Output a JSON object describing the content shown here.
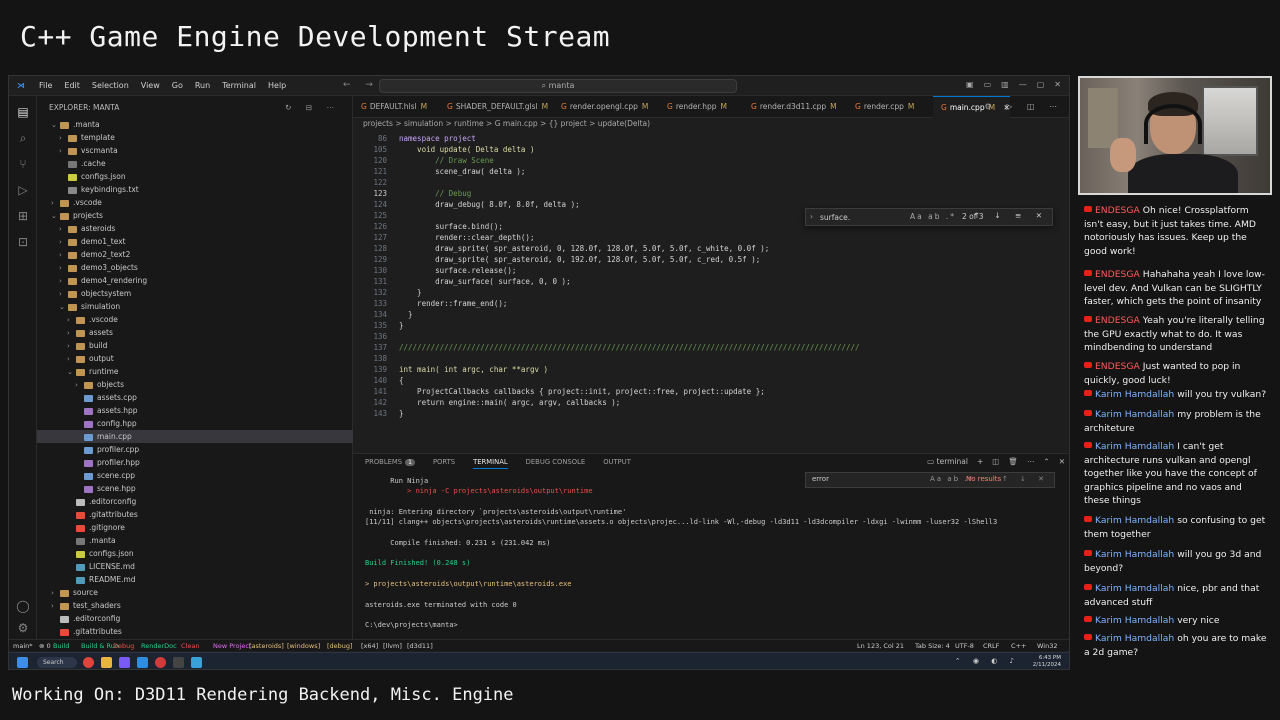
{
  "overlay": {
    "title": "C++ Game Engine Development Stream",
    "footer": "Working On: D3D11 Rendering Backend, Misc. Engine"
  },
  "titlebar": {
    "menu": [
      "File",
      "Edit",
      "Selection",
      "View",
      "Go",
      "Run",
      "Terminal",
      "Help"
    ],
    "search": "manta"
  },
  "activity_icons": [
    "files-icon",
    "search-icon",
    "source-control-icon",
    "run-debug-icon",
    "extensions-icon",
    "remote-icon",
    "accounts-icon",
    "settings-gear-icon"
  ],
  "explorer": {
    "header": "EXPLORER: MANTA",
    "items": [
      {
        "label": ".manta",
        "depth": 1,
        "kind": "folder",
        "open": true
      },
      {
        "label": "template",
        "depth": 2,
        "kind": "folder",
        "open": false
      },
      {
        "label": "vscmanta",
        "depth": 2,
        "kind": "folder",
        "open": false
      },
      {
        "label": ".cache",
        "depth": 2,
        "kind": "file"
      },
      {
        "label": "configs.json",
        "depth": 2,
        "kind": "json"
      },
      {
        "label": "keybindings.txt",
        "depth": 2,
        "kind": "txt"
      },
      {
        "label": ".vscode",
        "depth": 1,
        "kind": "folder",
        "open": false
      },
      {
        "label": "projects",
        "depth": 1,
        "kind": "folder",
        "open": true
      },
      {
        "label": "asteroids",
        "depth": 2,
        "kind": "folder",
        "open": false
      },
      {
        "label": "demo1_text",
        "depth": 2,
        "kind": "folder",
        "open": false
      },
      {
        "label": "demo2_text2",
        "depth": 2,
        "kind": "folder",
        "open": false
      },
      {
        "label": "demo3_objects",
        "depth": 2,
        "kind": "folder",
        "open": false
      },
      {
        "label": "demo4_rendering",
        "depth": 2,
        "kind": "folder",
        "open": false
      },
      {
        "label": "objectsystem",
        "depth": 2,
        "kind": "folder",
        "open": false
      },
      {
        "label": "simulation",
        "depth": 2,
        "kind": "folder",
        "open": true
      },
      {
        "label": ".vscode",
        "depth": 3,
        "kind": "folder",
        "open": false
      },
      {
        "label": "assets",
        "depth": 3,
        "kind": "folder",
        "open": false
      },
      {
        "label": "build",
        "depth": 3,
        "kind": "folder",
        "open": false
      },
      {
        "label": "output",
        "depth": 3,
        "kind": "folder",
        "open": false
      },
      {
        "label": "runtime",
        "depth": 3,
        "kind": "folder",
        "open": true
      },
      {
        "label": "objects",
        "depth": 4,
        "kind": "folder",
        "open": false
      },
      {
        "label": "assets.cpp",
        "depth": 4,
        "kind": "cpp"
      },
      {
        "label": "assets.hpp",
        "depth": 4,
        "kind": "hpp"
      },
      {
        "label": "config.hpp",
        "depth": 4,
        "kind": "hpp"
      },
      {
        "label": "main.cpp",
        "depth": 4,
        "kind": "cpp",
        "selected": true
      },
      {
        "label": "profiler.cpp",
        "depth": 4,
        "kind": "cpp"
      },
      {
        "label": "profiler.hpp",
        "depth": 4,
        "kind": "hpp"
      },
      {
        "label": "scene.cpp",
        "depth": 4,
        "kind": "cpp"
      },
      {
        "label": "scene.hpp",
        "depth": 4,
        "kind": "hpp"
      },
      {
        "label": ".editorconfig",
        "depth": 3,
        "kind": "config"
      },
      {
        "label": ".gitattributes",
        "depth": 3,
        "kind": "git"
      },
      {
        "label": ".gitignore",
        "depth": 3,
        "kind": "git"
      },
      {
        "label": ".manta",
        "depth": 3,
        "kind": "file"
      },
      {
        "label": "configs.json",
        "depth": 3,
        "kind": "json"
      },
      {
        "label": "LICENSE.md",
        "depth": 3,
        "kind": "md"
      },
      {
        "label": "README.md",
        "depth": 3,
        "kind": "md"
      },
      {
        "label": "source",
        "depth": 1,
        "kind": "folder",
        "open": false
      },
      {
        "label": "test_shaders",
        "depth": 1,
        "kind": "folder",
        "open": false
      },
      {
        "label": ".editorconfig",
        "depth": 1,
        "kind": "config"
      },
      {
        "label": ".gitattributes",
        "depth": 1,
        "kind": "git"
      }
    ]
  },
  "tabs": [
    {
      "label": "DEFAULT.hlsl",
      "flag": "M",
      "active": false
    },
    {
      "label": "SHADER_DEFAULT.glsl",
      "flag": "M",
      "active": false
    },
    {
      "label": "render.opengl.cpp",
      "flag": "M",
      "active": false
    },
    {
      "label": "render.hpp",
      "flag": "M",
      "active": false
    },
    {
      "label": "render.d3d11.cpp",
      "flag": "M",
      "active": false
    },
    {
      "label": "render.cpp",
      "flag": "M",
      "active": false
    },
    {
      "label": "main.cpp",
      "flag": "M",
      "active": true
    }
  ],
  "breadcrumb": "projects > simulation > runtime > G main.cpp > {} project > update(Delta)",
  "code_lines": [
    {
      "n": "86",
      "text": "namespace project",
      "style": "keyword"
    },
    {
      "n": "105",
      "text": "    void update( Delta delta )",
      "style": "func"
    },
    {
      "n": "120",
      "text": "        // Draw Scene",
      "style": "comment"
    },
    {
      "n": "121",
      "text": "        scene_draw( delta );",
      "style": "plain"
    },
    {
      "n": "122",
      "text": "",
      "style": "plain"
    },
    {
      "n": "123",
      "text": "        // Debug",
      "style": "comment",
      "current": true
    },
    {
      "n": "124",
      "text": "        draw_debug( 8.0f, 8.0f, delta );",
      "style": "plain"
    },
    {
      "n": "125",
      "text": "",
      "style": "plain"
    },
    {
      "n": "126",
      "text": "        surface.bind();",
      "style": "plain"
    },
    {
      "n": "127",
      "text": "        render::clear_depth();",
      "style": "plain"
    },
    {
      "n": "128",
      "text": "        draw_sprite( spr_asteroid, 0, 128.0f, 128.0f, 5.0f, 5.0f, c_white, 0.0f );",
      "style": "plain"
    },
    {
      "n": "129",
      "text": "        draw_sprite( spr_asteroid, 0, 192.0f, 128.0f, 5.0f, 5.0f, c_red, 0.5f );",
      "style": "plain"
    },
    {
      "n": "130",
      "text": "        surface.release();",
      "style": "plain"
    },
    {
      "n": "131",
      "text": "        draw_surface( surface, 0, 0 );",
      "style": "plain"
    },
    {
      "n": "132",
      "text": "    }",
      "style": "plain"
    },
    {
      "n": "133",
      "text": "    render::frame_end();",
      "style": "plain"
    },
    {
      "n": "134",
      "text": "  }",
      "style": "plain"
    },
    {
      "n": "135",
      "text": "}",
      "style": "plain"
    },
    {
      "n": "136",
      "text": "",
      "style": "plain"
    },
    {
      "n": "137",
      "text": "//////////////////////////////////////////////////////////////////////////////////////////////////////",
      "style": "comment"
    },
    {
      "n": "138",
      "text": "",
      "style": "plain"
    },
    {
      "n": "139",
      "text": "int main( int argc, char **argv )",
      "style": "func"
    },
    {
      "n": "140",
      "text": "{",
      "style": "plain"
    },
    {
      "n": "141",
      "text": "    ProjectCallbacks callbacks { project::init, project::free, project::update };",
      "style": "plain"
    },
    {
      "n": "142",
      "text": "    return engine::main( argc, argv, callbacks );",
      "style": "plain"
    },
    {
      "n": "143",
      "text": "}",
      "style": "plain"
    }
  ],
  "find_widget": {
    "query": "surface.",
    "options": "Aa ab .*",
    "count": "2 of 3"
  },
  "panel": {
    "tabs": [
      "PROBLEMS",
      "PORTS",
      "TERMINAL",
      "DEBUG CONSOLE",
      "OUTPUT"
    ],
    "problems_count": "1",
    "terminal_name": "terminal",
    "find_query": "error",
    "find_result": "No results",
    "terminal_lines": [
      {
        "text": "      Run Ninja",
        "color": "plain"
      },
      {
        "text": "          > ninja -C projects\\asteroids\\output\\runtime",
        "color": "red"
      },
      {
        "text": "",
        "color": "plain"
      },
      {
        "text": " ninja: Entering directory `projects\\asteroids\\output\\runtime'",
        "color": "plain"
      },
      {
        "text": "[11/11] clang++ objects\\projects\\asteroids\\runtime\\assets.o objects\\projec...ld-link -Wl,-debug -ld3d11 -ld3dcompiler -ldxgi -lwinmm -luser32 -lShell3",
        "color": "plain"
      },
      {
        "text": "",
        "color": "plain"
      },
      {
        "text": "      Compile finished: 0.231 s (231.042 ms)",
        "color": "plain"
      },
      {
        "text": "",
        "color": "plain"
      },
      {
        "text": "Build Finished! (0.248 s)",
        "color": "green"
      },
      {
        "text": "",
        "color": "plain"
      },
      {
        "text": "> projects\\asteroids\\output\\runtime\\asteroids.exe",
        "color": "yellow"
      },
      {
        "text": "",
        "color": "plain"
      },
      {
        "text": "asteroids.exe terminated with code 0",
        "color": "plain"
      },
      {
        "text": "",
        "color": "plain"
      },
      {
        "text": "C:\\dev\\projects\\manta>",
        "color": "plain"
      }
    ]
  },
  "statusbar": {
    "left": [
      "main*",
      "⊗ 0",
      "Build",
      "Build & Run",
      "Debug",
      "RenderDoc",
      "Clean",
      "New Project",
      "[asteroids]",
      "[windows]",
      "[debug]",
      "[x64]",
      "[llvm]",
      "[d3d11]"
    ],
    "position": "Ln 123, Col 21",
    "tabsize": "Tab Size: 4",
    "encoding": "UTF-8",
    "eol": "CRLF",
    "lang": "C++",
    "platform": "Win32"
  },
  "taskbar": {
    "search": "Search",
    "time": "6:43 PM",
    "date": "2/11/2024"
  },
  "chat": [
    {
      "author": "ENDESGA",
      "text": "Oh nice! Crossplatform isn't easy, but it just takes time. AMD notoriously has issues. Keep up the good work!"
    },
    {
      "author": "ENDESGA",
      "text": "Hahahaha yeah I love low-level dev. And Vulkan can be SLIGHTLY faster, which gets the point of insanity"
    },
    {
      "author": "ENDESGA",
      "text": "Yeah you're literally telling the GPU exactly what to do. It was mindbending to understand"
    },
    {
      "author": "ENDESGA",
      "text": "Just wanted to pop in quickly, good luck!"
    },
    {
      "author": "Karim Hamdallah",
      "text": "will you try vulkan?"
    },
    {
      "author": "Karim Hamdallah",
      "text": "my problem is the architeture"
    },
    {
      "author": "Karim Hamdallah",
      "text": "I can't get architecture runs vulkan and opengl together like you have the concept of graphics pipeline and no vaos and these things"
    },
    {
      "author": "Karim Hamdallah",
      "text": "so confusing to get them together"
    },
    {
      "author": "Karim Hamdallah",
      "text": "will you go 3d and beyond?"
    },
    {
      "author": "Karim Hamdallah",
      "text": "nice, pbr and that advanced stuff"
    },
    {
      "author": "Karim Hamdallah",
      "text": "very nice"
    },
    {
      "author": "Karim Hamdallah",
      "text": "oh you are to make a 2d game?"
    }
  ]
}
